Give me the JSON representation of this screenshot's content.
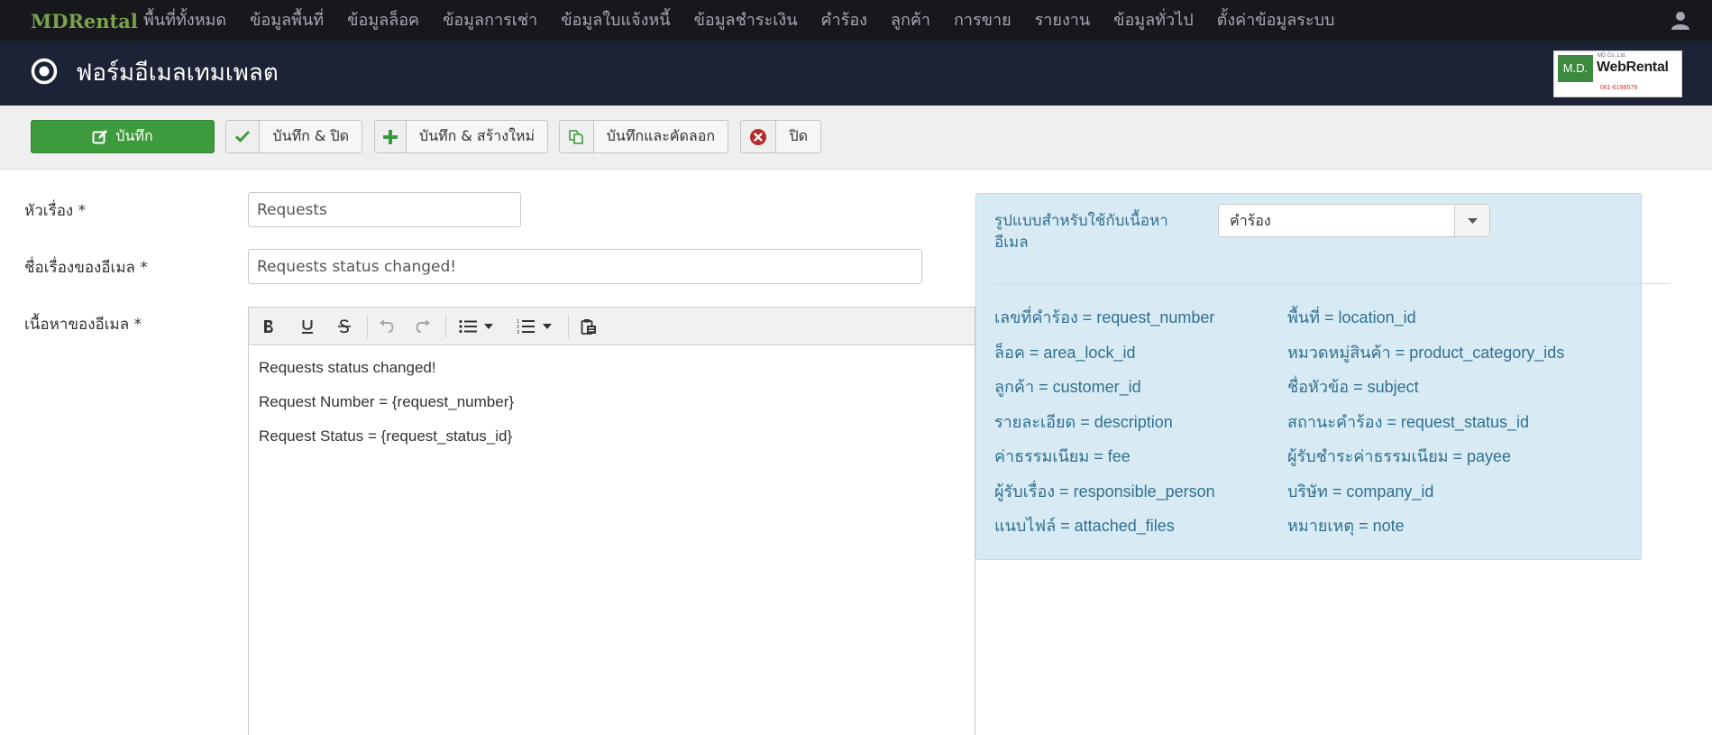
{
  "nav": {
    "brand": "MDRental",
    "items": [
      "พื้นที่ทั้งหมด",
      "ข้อมูลพื้นที่",
      "ข้อมูลล็อค",
      "ข้อมูลการเช่า",
      "ข้อมูลใบแจ้งหนี้",
      "ข้อมูลชำระเงิน",
      "คำร้อง",
      "ลูกค้า",
      "การขาย",
      "รายงาน",
      "ข้อมูลทั่วไป",
      "ตั้งค่าข้อมูลระบบ"
    ]
  },
  "header": {
    "title": "ฟอร์มอีเมลเทมเพลต",
    "logo": {
      "md": "M.D.",
      "small": "MD Co.,Ltd.",
      "name": "WebRental",
      "phone": "081-6198579"
    }
  },
  "toolbar": {
    "save": "บันทึก",
    "save_close": "บันทึก & ปิด",
    "save_new": "บันทึก & สร้างใหม่",
    "save_copy": "บันทึกและคัดลอก",
    "close": "ปิด"
  },
  "form": {
    "title_label": "หัวเรื่อง *",
    "title_value": "Requests",
    "subject_label": "ชื่อเรื่องของอีเมล *",
    "subject_value": "Requests status changed!",
    "body_label": "เนื้อหาของอีเมล *",
    "body_lines": [
      "Requests status changed!",
      "Request Number = {request_number}",
      "Request Status = {request_status_id}"
    ]
  },
  "panel": {
    "format_label": "รูปแบบสำหรับใช้กับเนื้อหาอีเมล",
    "format_value": "คำร้อง",
    "variables": [
      "เลขที่คำร้อง = request_number",
      "พื้นที่ = location_id",
      "ล็อค = area_lock_id",
      "หมวดหมู่สินค้า = product_category_ids",
      "ลูกค้า = customer_id",
      "ชื่อหัวข้อ = subject",
      "รายละเอียด = description",
      "สถานะคำร้อง = request_status_id",
      "ค่าธรรมเนียม = fee",
      "ผู้รับชำระค่าธรรมเนียม = payee",
      "ผู้รับเรื่อง = responsible_person",
      "บริษัท = company_id",
      "แนบไฟล์ = attached_files",
      "หมายเหตุ = note"
    ]
  },
  "colors": {
    "navbar": "#17181c",
    "header": "#1d2336",
    "brand": "#7aa24f",
    "save_button": "#3d9a3d",
    "panel_bg": "#d8ebf4",
    "panel_text": "#31708f"
  }
}
